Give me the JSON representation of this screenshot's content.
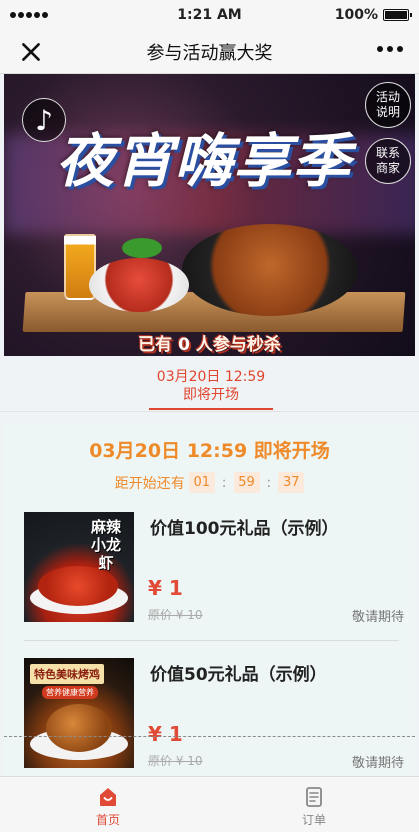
{
  "status_bar": {
    "time": "1:21 AM",
    "battery": "100%"
  },
  "nav": {
    "title": "参与活动赢大奖"
  },
  "banner": {
    "title": "夜宵嗨享季",
    "rules_button": "活动说明",
    "contact_button": "联系商家",
    "participants_prefix": "已有",
    "participants_count": "0",
    "participants_suffix": "人参与秒杀"
  },
  "session_tab": {
    "time": "03月20日 12:59",
    "status": "即将开场"
  },
  "main": {
    "headline": "03月20日 12:59 即将开场",
    "countdown_label": "距开始还有",
    "countdown": {
      "hours": "01",
      "minutes": "59",
      "seconds": "37"
    }
  },
  "products": [
    {
      "name": "价值100元礼品（示例）",
      "thumb_text": "麻辣小龙虾",
      "price": "¥ 1",
      "original_price": "原价 ¥ 10",
      "status": "敬请期待"
    },
    {
      "name": "价值50元礼品（示例）",
      "thumb_text": "特色美味烤鸡",
      "thumb_subtext": "营养健康营养",
      "price": "¥ 1",
      "original_price": "原价 ¥ 10",
      "status": "敬请期待"
    }
  ],
  "tabbar": {
    "home_label": "首页",
    "orders_label": "订单"
  },
  "colors": {
    "accent": "#e04a36",
    "orange": "#ef8a2a"
  }
}
